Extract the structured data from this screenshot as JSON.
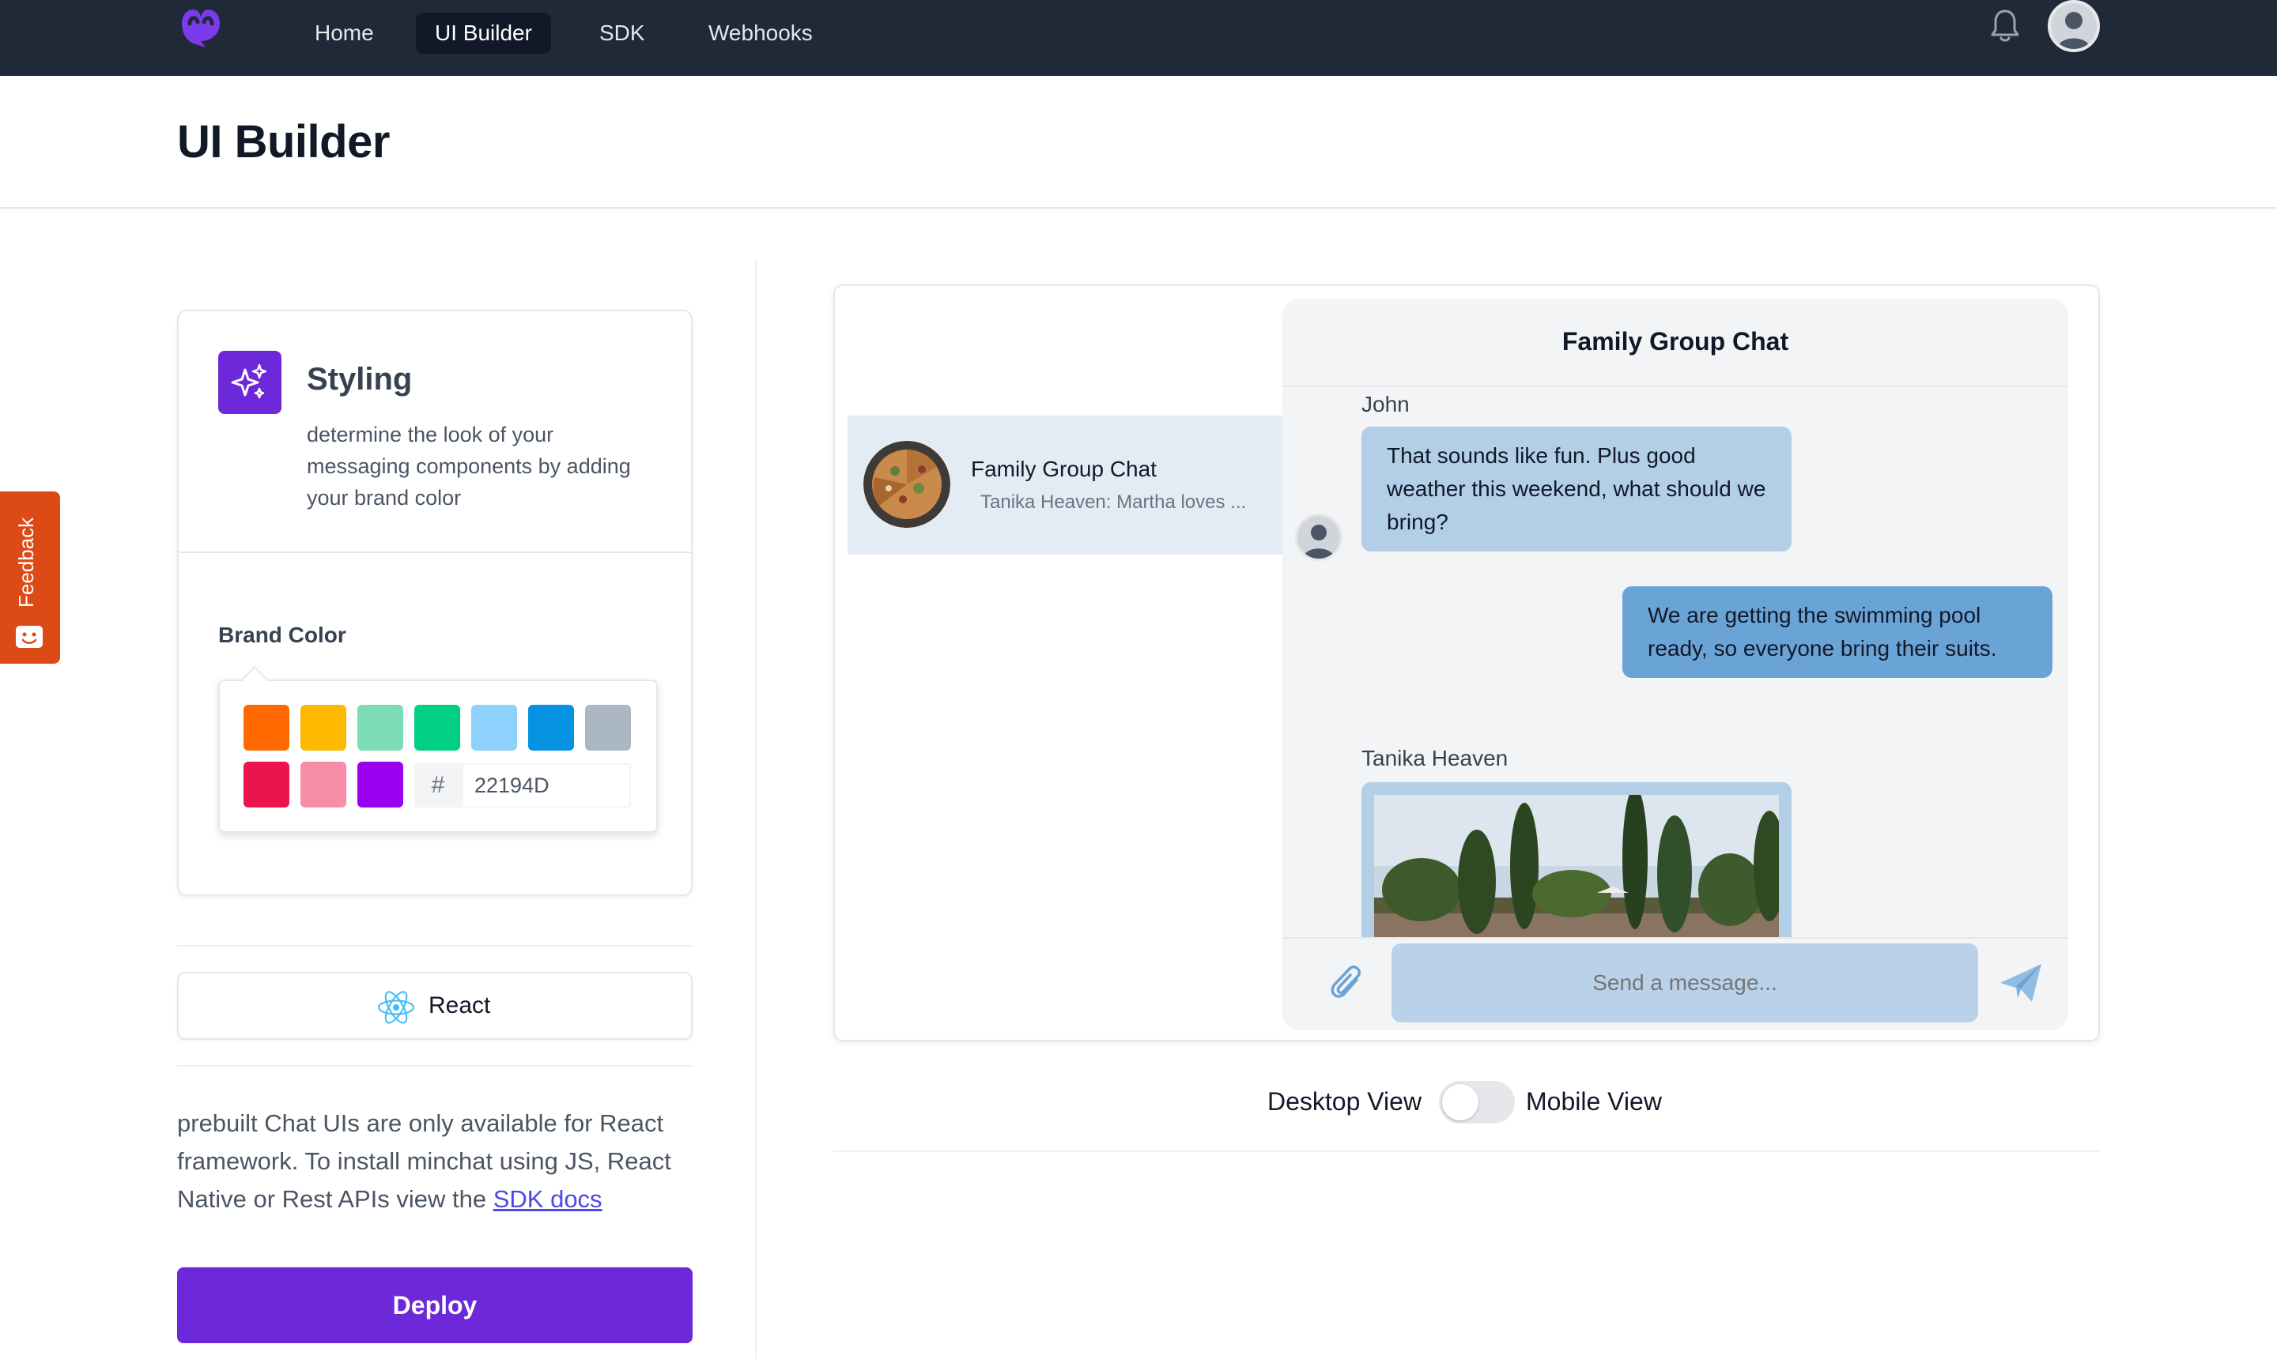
{
  "nav": {
    "links": [
      {
        "label": "Home",
        "active": false
      },
      {
        "label": "UI Builder",
        "active": true
      },
      {
        "label": "SDK",
        "active": false
      },
      {
        "label": "Webhooks",
        "active": false
      }
    ],
    "icons": {
      "logo": "minchat-logo",
      "notifications": "bell-icon",
      "profile": "user-avatar"
    }
  },
  "page": {
    "title": "UI Builder"
  },
  "feedback": {
    "label": "Feedback",
    "icon": "smile-chat-icon"
  },
  "styling": {
    "icon": "sparkles-icon",
    "title": "Styling",
    "description": "determine the look of your messaging components by adding your brand color",
    "brand_label": "Brand Color",
    "swatches": [
      "#ff6900",
      "#fcb900",
      "#7bdcb5",
      "#00d084",
      "#8ed1fc",
      "#0693e3",
      "#abb8c3",
      "#eb144c",
      "#f78da7",
      "#9900ef"
    ],
    "hash_symbol": "#",
    "hex_value": "22194D"
  },
  "framework": {
    "label": "React",
    "icon": "react-icon"
  },
  "info": {
    "text": "prebuilt Chat UIs are only available for React framework. To install minchat using JS, React Native or Rest APIs view the ",
    "link_text": "SDK docs"
  },
  "deploy": {
    "label": "Deploy"
  },
  "preview": {
    "chat_list": [
      {
        "name": "Family Group Chat",
        "last_message": "Tanika Heaven: Martha loves ..."
      }
    ],
    "chat": {
      "title": "Family Group Chat",
      "messages": [
        {
          "sender": "John",
          "text": "That sounds like fun. Plus good weather this weekend, what should we bring?",
          "direction": "in"
        },
        {
          "sender": "",
          "text": "We are getting the swimming pool ready, so everyone bring their suits.",
          "direction": "out"
        },
        {
          "sender": "Tanika Heaven",
          "text": "",
          "direction": "in",
          "attachment": "garden-photo"
        }
      ],
      "input_placeholder": "Send a message...",
      "icons": {
        "attach": "paperclip-icon",
        "send": "send-icon"
      }
    },
    "colors": {
      "incoming": "#b3cfe8",
      "outgoing": "#6aa3d6",
      "list_selected": "#e3ecf5"
    }
  },
  "view_toggle": {
    "left_label": "Desktop View",
    "right_label": "Mobile View",
    "mobile_on": false
  },
  "colors": {
    "nav_bg": "#1f2937",
    "primary": "#6d28d9",
    "feedback": "#dc4a16",
    "link": "#4f46e5"
  }
}
